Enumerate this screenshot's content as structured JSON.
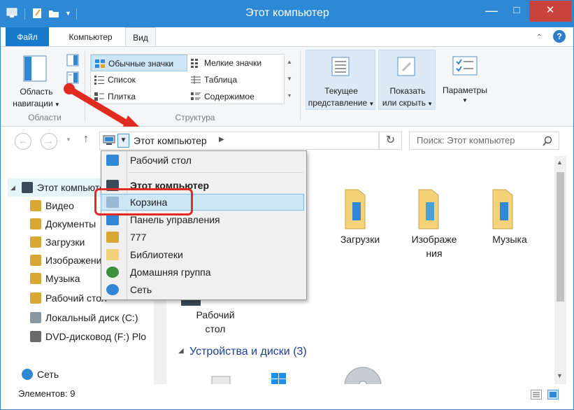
{
  "window": {
    "title": "Этот компьютер",
    "controls": {
      "minimize": "—",
      "maximize": "□",
      "close": "✕"
    }
  },
  "tabs": {
    "file": "Файл",
    "computer": "Компьютер",
    "view": "Вид"
  },
  "ribbon": {
    "panes": {
      "nav_pane_label_line1": "Область",
      "nav_pane_label_line2": "навигации",
      "group_label": "Области"
    },
    "layout": {
      "items": [
        "Обычные значки",
        "Мелкие значки",
        "Список",
        "Таблица",
        "Плитка",
        "Содержимое"
      ],
      "selected": "Обычные значки",
      "group_label": "Структура"
    },
    "current_view": {
      "line1": "Текущее",
      "line2": "представление"
    },
    "show_hide": {
      "line1": "Показать",
      "line2": "или скрыть"
    },
    "options": {
      "label": "Параметры"
    }
  },
  "navbar": {
    "address_path": "Этот компьютер",
    "search_placeholder": "Поиск: Этот компьютер"
  },
  "dropdown": {
    "items": [
      {
        "label": "Рабочий стол",
        "bold": false
      },
      {
        "label": "Этот компьютер",
        "bold": true
      },
      {
        "label": "Корзина",
        "bold": false,
        "highlighted": true
      },
      {
        "label": "Панель управления",
        "bold": false
      },
      {
        "label": "777",
        "bold": false
      },
      {
        "label": "Библиотеки",
        "bold": false
      },
      {
        "label": "Домашняя группа",
        "bold": false
      },
      {
        "label": "Сеть",
        "bold": false
      }
    ]
  },
  "nav_pane": {
    "items": [
      {
        "label": "Этот компьютер",
        "icon": "computer-icon",
        "selected": true
      },
      {
        "label": "Видео",
        "icon": "video-folder-icon"
      },
      {
        "label": "Документы",
        "icon": "documents-folder-icon"
      },
      {
        "label": "Загрузки",
        "icon": "downloads-folder-icon"
      },
      {
        "label": "Изображения",
        "icon": "pictures-folder-icon"
      },
      {
        "label": "Музыка",
        "icon": "music-folder-icon"
      },
      {
        "label": "Рабочий стол",
        "icon": "desktop-folder-icon"
      },
      {
        "label": "Локальный диск (C:)",
        "icon": "local-disk-icon"
      },
      {
        "label": "DVD-дисковод (F:) Plo",
        "icon": "dvd-drive-icon"
      },
      {
        "label": "Сеть",
        "icon": "network-icon"
      }
    ]
  },
  "content": {
    "folders": [
      {
        "label": "ты",
        "icon": "documents-folder-icon"
      },
      {
        "label": "Загрузки",
        "icon": "downloads-folder-icon"
      },
      {
        "label": "Изображе\nния",
        "icon": "pictures-folder-icon"
      },
      {
        "label": "Музыка",
        "icon": "music-folder-icon"
      }
    ],
    "desktop_label": "Рабочий\nстол",
    "section_devices": "Устройства и диски (3)"
  },
  "status": {
    "items_count": "Элементов: 9"
  },
  "colors": {
    "titlebar": "#2d89d6",
    "file_tab": "#1979ca",
    "highlight_red": "#e22b20",
    "selection": "#cce6f6"
  }
}
